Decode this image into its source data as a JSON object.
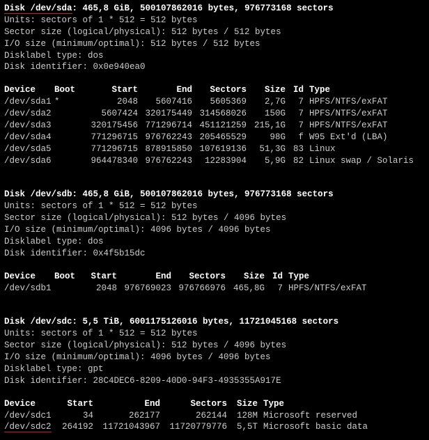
{
  "diskA": {
    "header": "Disk /dev/sda: 465,8 GiB, 500107862016 bytes, 976773168 sectors",
    "units": "Units: sectors of 1 * 512 = 512 bytes",
    "sector": "Sector size (logical/physical): 512 bytes / 512 bytes",
    "io": "I/O size (minimum/optimal): 512 bytes / 512 bytes",
    "label": "Disklabel type: dos",
    "ident": "Disk identifier: 0x0e940ea0",
    "cols": {
      "device": "Device",
      "boot": "Boot",
      "start": "Start",
      "end": "End",
      "sectors": "Sectors",
      "size": "Size",
      "id": "Id",
      "type": "Type"
    },
    "rows": [
      {
        "device": "/dev/sda1",
        "boot": "*",
        "start": "2048",
        "end": "5607416",
        "sectors": "5605369",
        "size": "2,7G",
        "id": "7",
        "type": "HPFS/NTFS/exFAT"
      },
      {
        "device": "/dev/sda2",
        "boot": "",
        "start": "5607424",
        "end": "320175449",
        "sectors": "314568026",
        "size": "150G",
        "id": "7",
        "type": "HPFS/NTFS/exFAT"
      },
      {
        "device": "/dev/sda3",
        "boot": "",
        "start": "320175456",
        "end": "771296714",
        "sectors": "451121259",
        "size": "215,1G",
        "id": "7",
        "type": "HPFS/NTFS/exFAT"
      },
      {
        "device": "/dev/sda4",
        "boot": "",
        "start": "771296715",
        "end": "976762243",
        "sectors": "205465529",
        "size": "98G",
        "id": "f",
        "type": "W95 Ext'd (LBA)"
      },
      {
        "device": "/dev/sda5",
        "boot": "",
        "start": "771296715",
        "end": "878915850",
        "sectors": "107619136",
        "size": "51,3G",
        "id": "83",
        "type": "Linux"
      },
      {
        "device": "/dev/sda6",
        "boot": "",
        "start": "964478340",
        "end": "976762243",
        "sectors": "12283904",
        "size": "5,9G",
        "id": "82",
        "type": "Linux swap / Solaris"
      }
    ]
  },
  "diskB": {
    "header": "Disk /dev/sdb: 465,8 GiB, 500107862016 bytes, 976773168 sectors",
    "units": "Units: sectors of 1 * 512 = 512 bytes",
    "sector": "Sector size (logical/physical): 512 bytes / 4096 bytes",
    "io": "I/O size (minimum/optimal): 4096 bytes / 4096 bytes",
    "label": "Disklabel type: dos",
    "ident": "Disk identifier: 0x4f5b15dc",
    "cols": {
      "device": "Device",
      "boot": "Boot",
      "start": "Start",
      "end": "End",
      "sectors": "Sectors",
      "size": "Size",
      "id": "Id",
      "type": "Type"
    },
    "rows": [
      {
        "device": "/dev/sdb1",
        "boot": "",
        "start": "2048",
        "end": "976769023",
        "sectors": "976766976",
        "size": "465,8G",
        "id": "7",
        "type": "HPFS/NTFS/exFAT"
      }
    ]
  },
  "diskC": {
    "header": "Disk /dev/sdc: 5,5 TiB, 6001175126016 bytes, 11721045168 sectors",
    "units": "Units: sectors of 1 * 512 = 512 bytes",
    "sector": "Sector size (logical/physical): 512 bytes / 4096 bytes",
    "io": "I/O size (minimum/optimal): 4096 bytes / 4096 bytes",
    "label": "Disklabel type: gpt",
    "ident": "Disk identifier: 28C4DEC6-8209-40D0-94F3-4935355A917E",
    "cols": {
      "device": "Device",
      "start": "Start",
      "end": "End",
      "sectors": "Sectors",
      "size": "Size",
      "type": "Type"
    },
    "rows": [
      {
        "device": "/dev/sdc1",
        "start": "34",
        "end": "262177",
        "sectors": "262144",
        "size": "128M",
        "type": "Microsoft reserved"
      },
      {
        "device": "/dev/sdc2",
        "start": "264192",
        "end": "11721043967",
        "sectors": "11720779776",
        "size": "5,5T",
        "type": "Microsoft basic data"
      }
    ]
  }
}
